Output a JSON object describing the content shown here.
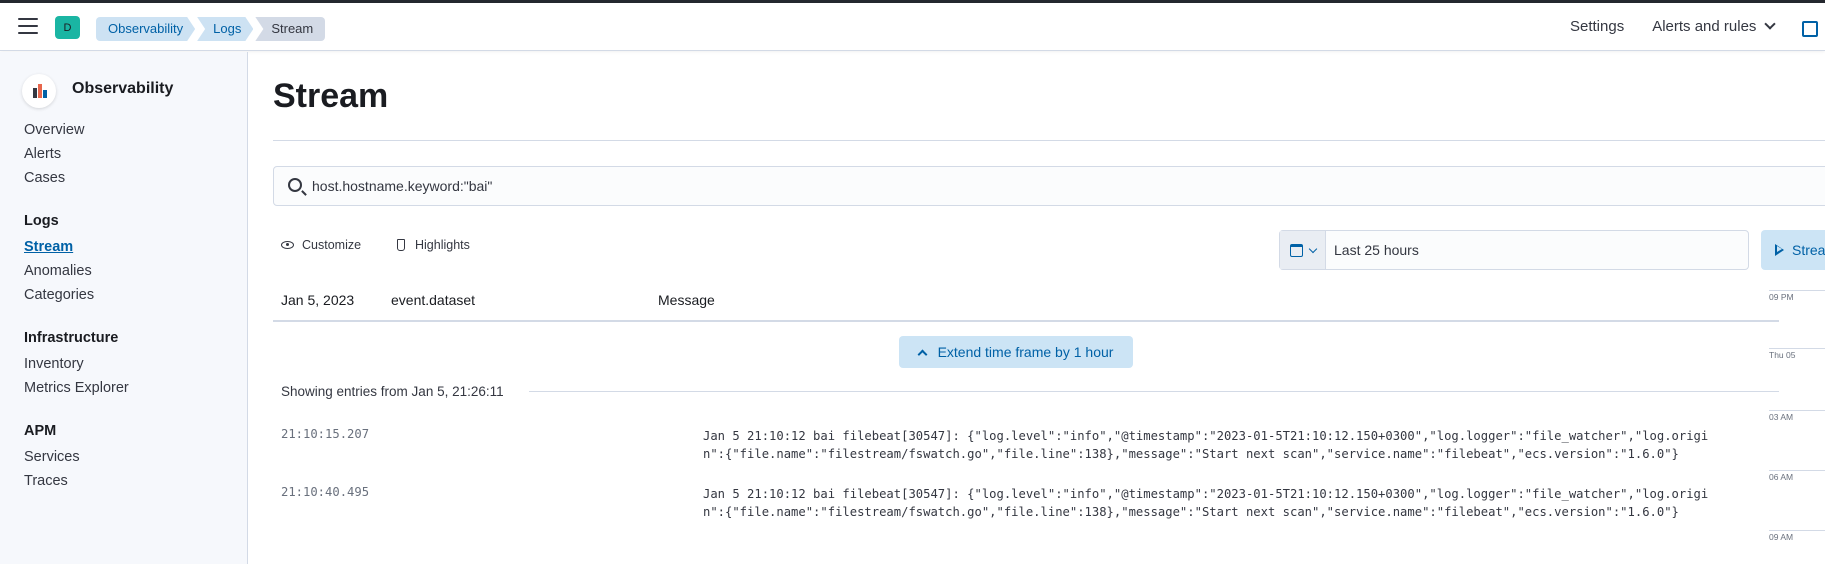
{
  "header": {
    "space_initial": "D",
    "breadcrumbs": [
      "Observability",
      "Logs",
      "Stream"
    ],
    "settings_label": "Settings",
    "alerts_label": "Alerts and rules"
  },
  "sidebar": {
    "title": "Observability",
    "items": {
      "overview": "Overview",
      "alerts": "Alerts",
      "cases": "Cases"
    },
    "logs": {
      "group": "Logs",
      "stream": "Stream",
      "anomalies": "Anomalies",
      "categories": "Categories"
    },
    "infrastructure": {
      "group": "Infrastructure",
      "inventory": "Inventory",
      "metrics_explorer": "Metrics Explorer"
    },
    "apm": {
      "group": "APM",
      "services": "Services",
      "traces": "Traces"
    }
  },
  "main": {
    "title": "Stream",
    "search_value": "host.hostname.keyword:\"bai\"",
    "customize_label": "Customize",
    "highlights_label": "Highlights",
    "time_range": "Last 25 hours",
    "stream_button": "Strea",
    "columns": {
      "date": "Jan 5, 2023",
      "dataset": "event.dataset",
      "message": "Message"
    },
    "extend_label": "Extend time frame by 1 hour",
    "showing_text": "Showing entries from Jan 5, 21:26:11",
    "entries": [
      {
        "time": "21:10:15.207",
        "message": "Jan 5 21:10:12 bai filebeat[30547]: {\"log.level\":\"info\",\"@timestamp\":\"2023-01-5T21:10:12.150+0300\",\"log.logger\":\"file_watcher\",\"log.origin\":{\"file.name\":\"filestream/fswatch.go\",\"file.line\":138},\"message\":\"Start next scan\",\"service.name\":\"filebeat\",\"ecs.version\":\"1.6.0\"}"
      },
      {
        "time": "21:10:40.495",
        "message": "Jan 5 21:10:12 bai filebeat[30547]: {\"log.level\":\"info\",\"@timestamp\":\"2023-01-5T21:10:12.150+0300\",\"log.logger\":\"file_watcher\",\"log.origin\":{\"file.name\":\"filestream/fswatch.go\",\"file.line\":138},\"message\":\"Start next scan\",\"service.name\":\"filebeat\",\"ecs.version\":\"1.6.0\"}"
      }
    ],
    "minimap_ticks": [
      "09 PM",
      "Thu 05",
      "03 AM",
      "06 AM",
      "09 AM"
    ]
  },
  "colors": {
    "accent": "#0061a6",
    "badge": "#1ab5a3",
    "sidebar_bg": "#f6f8fc"
  }
}
